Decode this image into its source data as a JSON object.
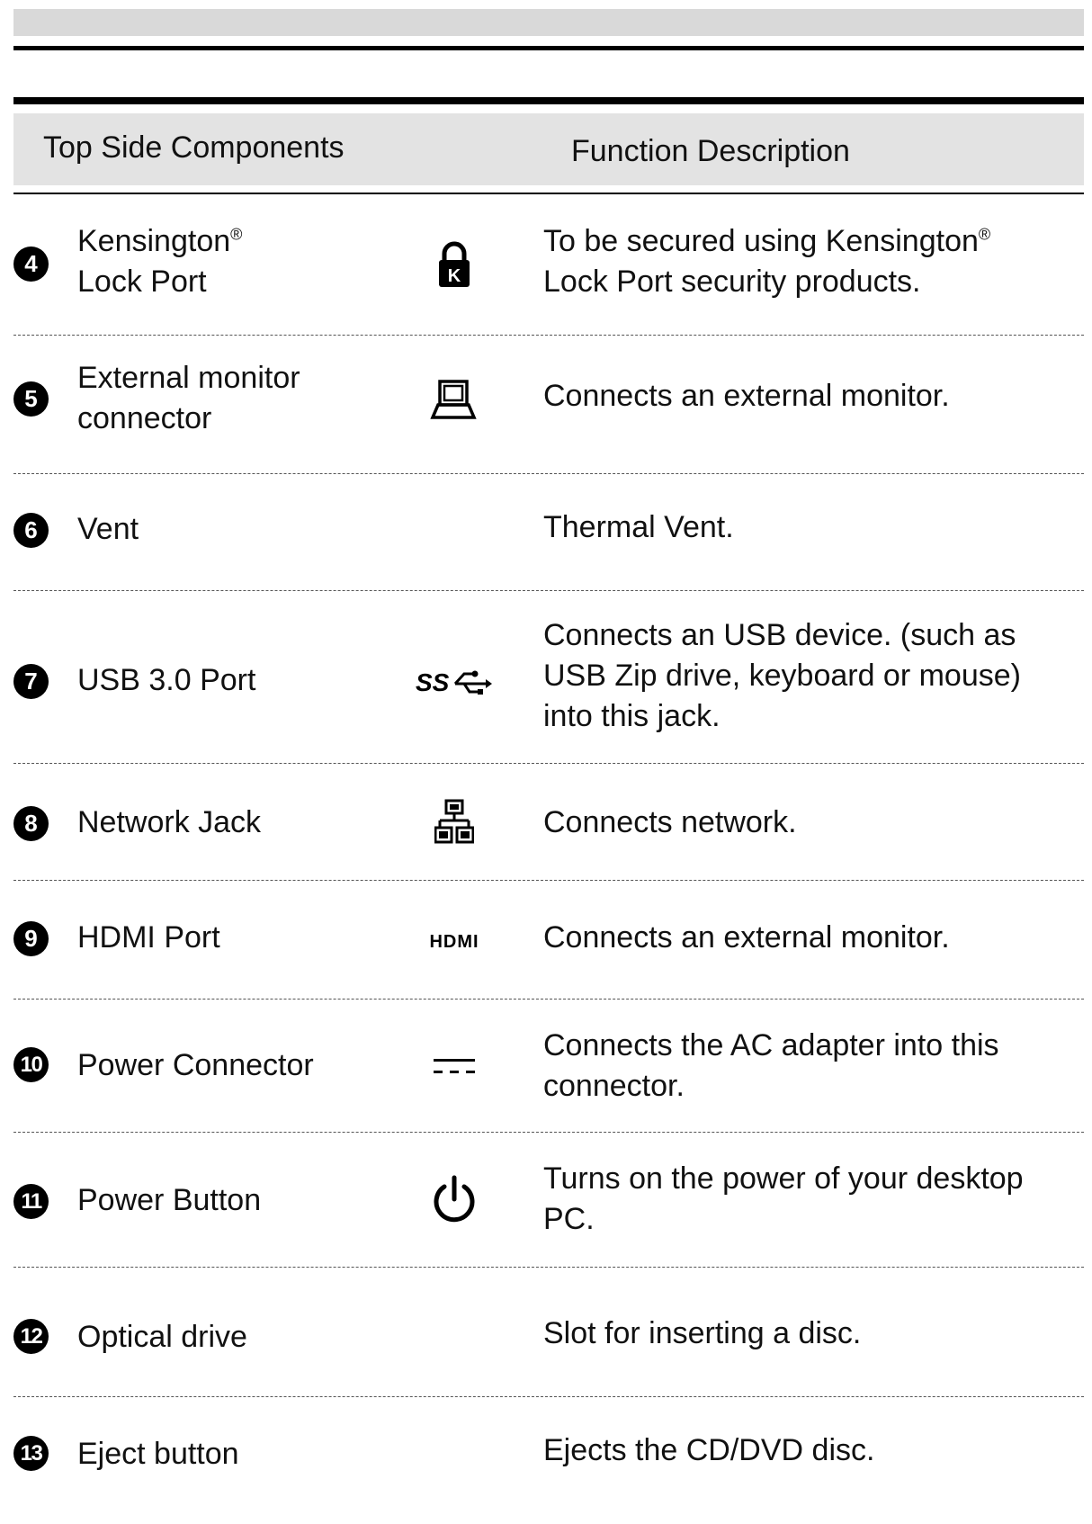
{
  "header": {
    "col_components": "Top Side Components",
    "col_description": "Function Description"
  },
  "rows": [
    {
      "number": "4",
      "name_line1": "Kensington",
      "name_sup": "®",
      "name_line2": "Lock Port",
      "icon": "kensington-lock-icon",
      "desc_line1": "To be secured using Kensington",
      "desc_sup": "®",
      "desc_line2": "Lock Port security products."
    },
    {
      "number": "5",
      "name_line1": "External monitor",
      "name_line2": "connector",
      "icon": "monitor-icon",
      "desc": "Connects an external monitor."
    },
    {
      "number": "6",
      "name": "Vent",
      "icon": "",
      "desc": "Thermal Vent."
    },
    {
      "number": "7",
      "name": "USB 3.0 Port",
      "icon": "usb3-icon",
      "desc_line1": "Connects an USB device. (such as",
      "desc_line2": "USB Zip drive, keyboard or mouse)",
      "desc_line3": "into this jack."
    },
    {
      "number": "8",
      "name": "Network Jack",
      "icon": "network-icon",
      "desc": "Connects network."
    },
    {
      "number": "9",
      "name": "HDMI Port",
      "icon": "hdmi-icon",
      "icon_text": "HDMI",
      "desc": "Connects an external monitor."
    },
    {
      "number": "10",
      "name": "Power Connector",
      "icon": "dc-power-icon",
      "desc_line1": "Connects the AC adapter into this",
      "desc_line2": "connector."
    },
    {
      "number": "11",
      "name": "Power Button",
      "icon": "power-icon",
      "desc_line1": "Turns on the power of your desktop",
      "desc_line2": "PC."
    },
    {
      "number": "12",
      "name": "Optical drive",
      "icon": "",
      "desc": "Slot for inserting a disc."
    },
    {
      "number": "13",
      "name": "Eject button",
      "icon": "",
      "desc": "Ejects the CD/DVD disc."
    }
  ]
}
